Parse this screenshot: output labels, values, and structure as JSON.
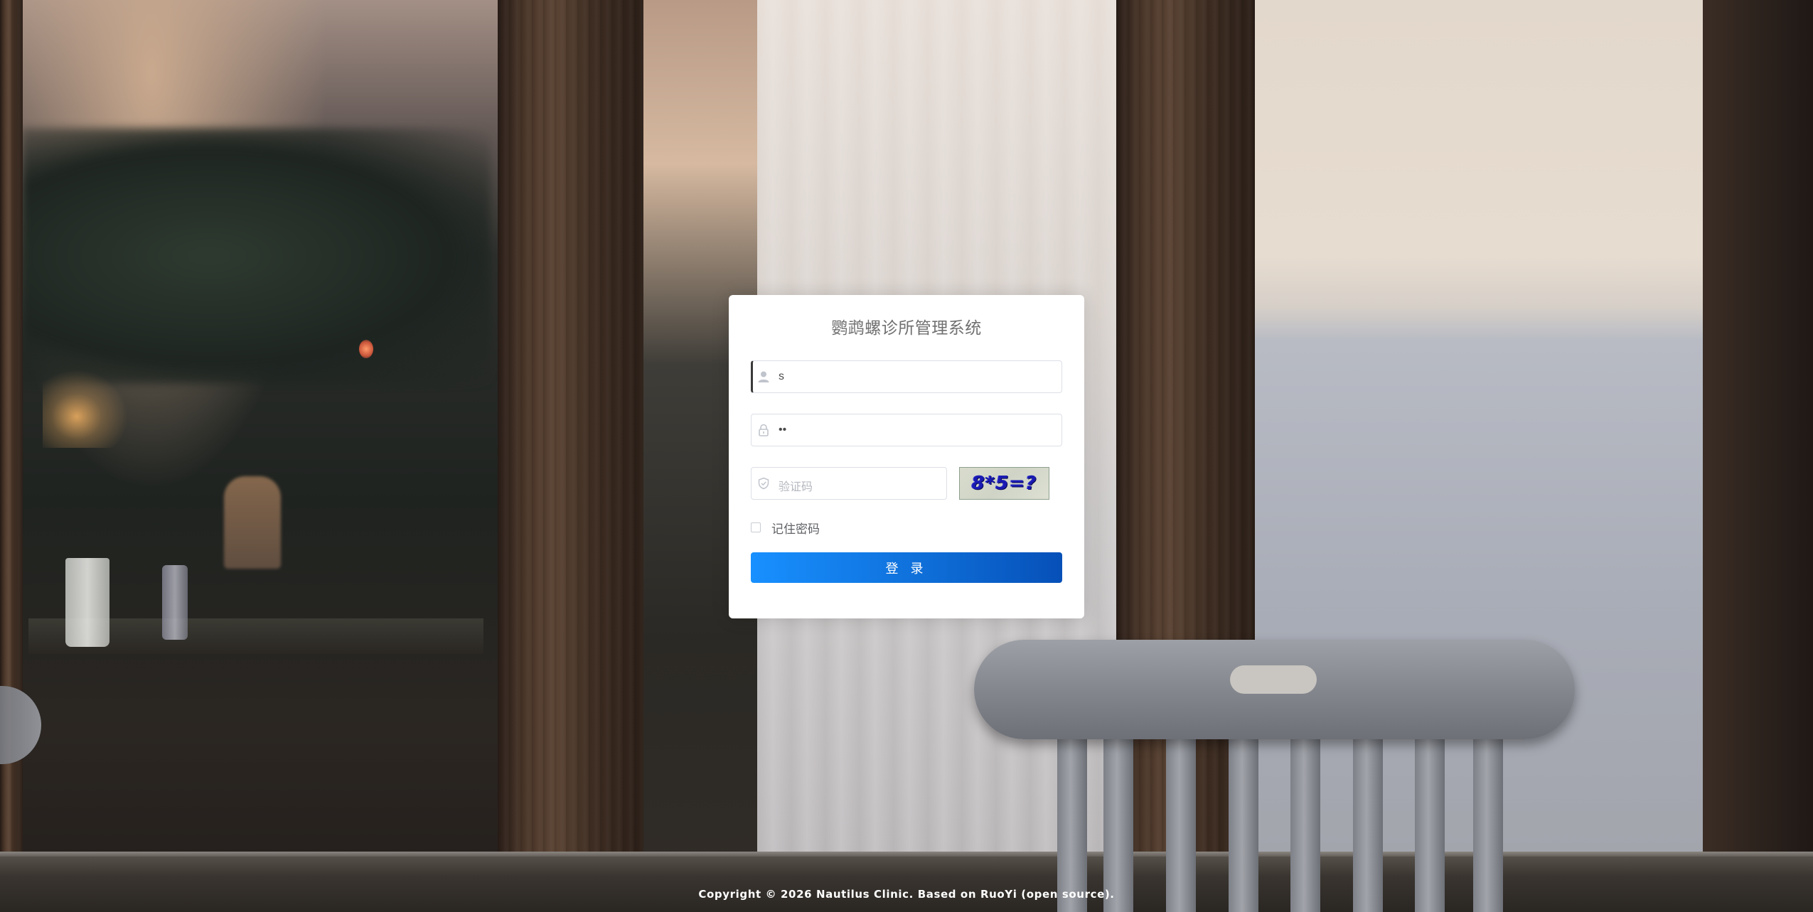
{
  "login": {
    "title": "鹦鹉螺诊所管理系统",
    "username": {
      "value": "s",
      "icon": "user-icon"
    },
    "password": {
      "value": "••",
      "icon": "lock-icon"
    },
    "captcha": {
      "placeholder": "验证码",
      "icon": "shield-check-icon",
      "image_text": "8*5=?"
    },
    "remember_label": "记住密码",
    "remember_checked": false,
    "submit_label": "登 录"
  },
  "footer": {
    "copyright": "Copyright © 2026 Nautilus Clinic. Based on RuoYi (open source)."
  },
  "colors": {
    "primary": "#1890ff",
    "primary_dark": "#0650b8",
    "title": "#707070",
    "input_border": "#dcdfe6"
  }
}
